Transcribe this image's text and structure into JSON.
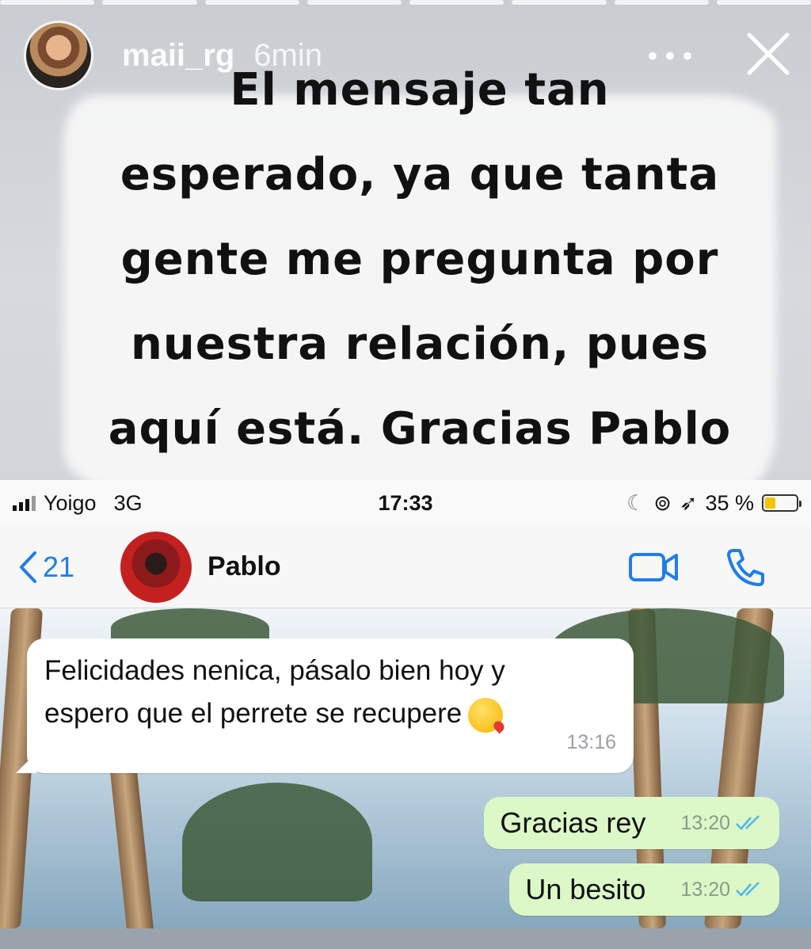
{
  "story": {
    "username": "maii_rg",
    "time": "6min",
    "more_icon": "more-icon",
    "close_icon": "close-icon",
    "caption_lines": [
      "El mensaje tan",
      "esperado, ya que tanta",
      "gente me pregunta por",
      "nuestra relación, pues",
      "aquí está. Gracias Pablo"
    ]
  },
  "status_bar": {
    "carrier": "Yoigo",
    "network": "3G",
    "clock": "17:33",
    "battery": "35 %",
    "battery_level": 0.35
  },
  "chat_header": {
    "back_count": "21",
    "contact_name": "Pablo"
  },
  "messages": {
    "incoming": {
      "text_line1": "Felicidades nenica, pásalo bien hoy y",
      "text_line2": "espero que el perrete se recupere",
      "time": "13:16"
    },
    "outgoing": [
      {
        "text": "Gracias rey",
        "time": "13:20"
      },
      {
        "text": "Un besito",
        "time": "13:20"
      }
    ]
  },
  "colors": {
    "ios_blue": "#1f7ee8",
    "bubble_out": "#dcf8c6",
    "read_ticks": "#4fb6ec"
  }
}
